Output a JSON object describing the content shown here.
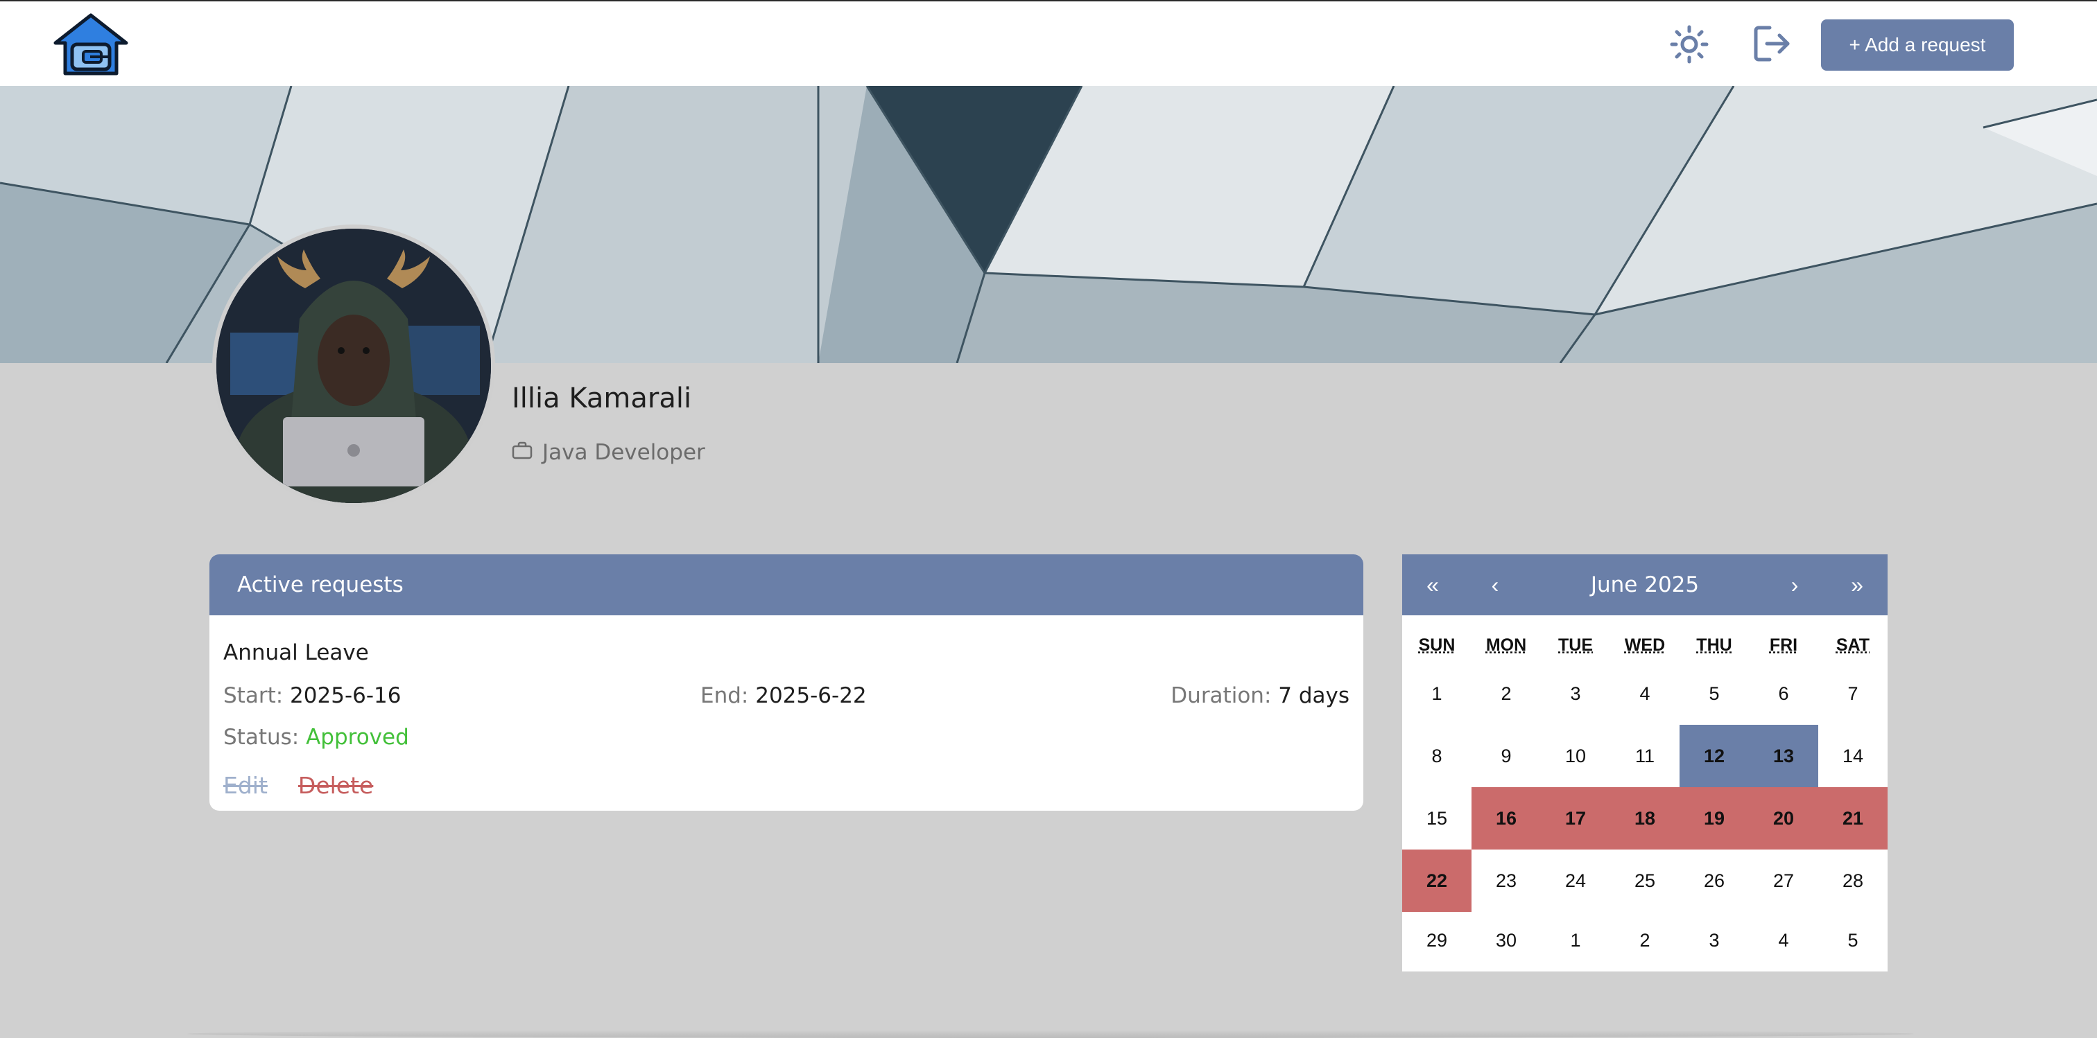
{
  "header": {
    "logo_icon": "house-logo-icon",
    "theme_icon": "sun-icon",
    "logout_icon": "logout-icon",
    "add_request_label": "+ Add a request"
  },
  "profile": {
    "name": "Illia Kamarali",
    "role_icon": "briefcase-icon",
    "role": "Java Developer"
  },
  "requests": {
    "title": "Active requests",
    "items": [
      {
        "type": "Annual Leave",
        "start_label": "Start:",
        "start": "2025-6-16",
        "end_label": "End:",
        "end": "2025-6-22",
        "duration_label": "Duration:",
        "duration": "7 days",
        "status_label": "Status:",
        "status": "Approved",
        "edit_label": "Edit",
        "delete_label": "Delete"
      }
    ]
  },
  "calendar": {
    "month_label": "June 2025",
    "prev_year": "«",
    "prev_month": "‹",
    "next_month": "›",
    "next_year": "»",
    "weekdays": [
      "SUN",
      "MON",
      "TUE",
      "WED",
      "THU",
      "FRI",
      "SAT"
    ],
    "days": [
      "1",
      "2",
      "3",
      "4",
      "5",
      "6",
      "7",
      "8",
      "9",
      "10",
      "11",
      "12",
      "13",
      "14",
      "15",
      "16",
      "17",
      "18",
      "19",
      "20",
      "21",
      "22",
      "23",
      "24",
      "25",
      "26",
      "27",
      "28",
      "29",
      "30",
      "1",
      "2",
      "3",
      "4",
      "5"
    ],
    "highlight_blue": [
      "12",
      "13"
    ],
    "highlight_red": [
      "16",
      "17",
      "18",
      "19",
      "20",
      "21",
      "22"
    ]
  },
  "colors": {
    "accent": "#6a7fa8",
    "approved": "#43c03a",
    "leave_range": "#cb6b6b",
    "page_background": "#d0d0d0"
  }
}
